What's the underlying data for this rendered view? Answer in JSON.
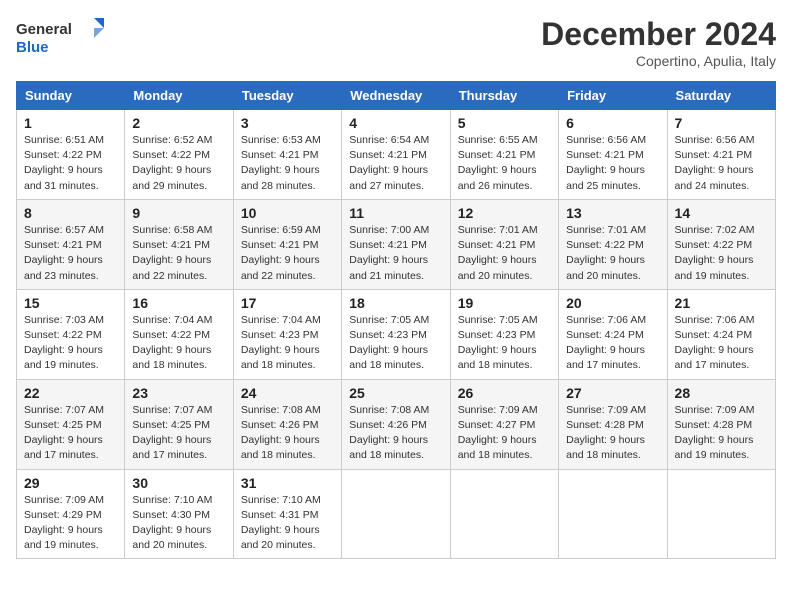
{
  "header": {
    "logo_line1": "General",
    "logo_line2": "Blue",
    "month": "December 2024",
    "location": "Copertino, Apulia, Italy"
  },
  "weekdays": [
    "Sunday",
    "Monday",
    "Tuesday",
    "Wednesday",
    "Thursday",
    "Friday",
    "Saturday"
  ],
  "weeks": [
    [
      {
        "day": "1",
        "sunrise": "6:51 AM",
        "sunset": "4:22 PM",
        "daylight": "9 hours and 31 minutes."
      },
      {
        "day": "2",
        "sunrise": "6:52 AM",
        "sunset": "4:22 PM",
        "daylight": "9 hours and 29 minutes."
      },
      {
        "day": "3",
        "sunrise": "6:53 AM",
        "sunset": "4:21 PM",
        "daylight": "9 hours and 28 minutes."
      },
      {
        "day": "4",
        "sunrise": "6:54 AM",
        "sunset": "4:21 PM",
        "daylight": "9 hours and 27 minutes."
      },
      {
        "day": "5",
        "sunrise": "6:55 AM",
        "sunset": "4:21 PM",
        "daylight": "9 hours and 26 minutes."
      },
      {
        "day": "6",
        "sunrise": "6:56 AM",
        "sunset": "4:21 PM",
        "daylight": "9 hours and 25 minutes."
      },
      {
        "day": "7",
        "sunrise": "6:56 AM",
        "sunset": "4:21 PM",
        "daylight": "9 hours and 24 minutes."
      }
    ],
    [
      {
        "day": "8",
        "sunrise": "6:57 AM",
        "sunset": "4:21 PM",
        "daylight": "9 hours and 23 minutes."
      },
      {
        "day": "9",
        "sunrise": "6:58 AM",
        "sunset": "4:21 PM",
        "daylight": "9 hours and 22 minutes."
      },
      {
        "day": "10",
        "sunrise": "6:59 AM",
        "sunset": "4:21 PM",
        "daylight": "9 hours and 22 minutes."
      },
      {
        "day": "11",
        "sunrise": "7:00 AM",
        "sunset": "4:21 PM",
        "daylight": "9 hours and 21 minutes."
      },
      {
        "day": "12",
        "sunrise": "7:01 AM",
        "sunset": "4:21 PM",
        "daylight": "9 hours and 20 minutes."
      },
      {
        "day": "13",
        "sunrise": "7:01 AM",
        "sunset": "4:22 PM",
        "daylight": "9 hours and 20 minutes."
      },
      {
        "day": "14",
        "sunrise": "7:02 AM",
        "sunset": "4:22 PM",
        "daylight": "9 hours and 19 minutes."
      }
    ],
    [
      {
        "day": "15",
        "sunrise": "7:03 AM",
        "sunset": "4:22 PM",
        "daylight": "9 hours and 19 minutes."
      },
      {
        "day": "16",
        "sunrise": "7:04 AM",
        "sunset": "4:22 PM",
        "daylight": "9 hours and 18 minutes."
      },
      {
        "day": "17",
        "sunrise": "7:04 AM",
        "sunset": "4:23 PM",
        "daylight": "9 hours and 18 minutes."
      },
      {
        "day": "18",
        "sunrise": "7:05 AM",
        "sunset": "4:23 PM",
        "daylight": "9 hours and 18 minutes."
      },
      {
        "day": "19",
        "sunrise": "7:05 AM",
        "sunset": "4:23 PM",
        "daylight": "9 hours and 18 minutes."
      },
      {
        "day": "20",
        "sunrise": "7:06 AM",
        "sunset": "4:24 PM",
        "daylight": "9 hours and 17 minutes."
      },
      {
        "day": "21",
        "sunrise": "7:06 AM",
        "sunset": "4:24 PM",
        "daylight": "9 hours and 17 minutes."
      }
    ],
    [
      {
        "day": "22",
        "sunrise": "7:07 AM",
        "sunset": "4:25 PM",
        "daylight": "9 hours and 17 minutes."
      },
      {
        "day": "23",
        "sunrise": "7:07 AM",
        "sunset": "4:25 PM",
        "daylight": "9 hours and 17 minutes."
      },
      {
        "day": "24",
        "sunrise": "7:08 AM",
        "sunset": "4:26 PM",
        "daylight": "9 hours and 18 minutes."
      },
      {
        "day": "25",
        "sunrise": "7:08 AM",
        "sunset": "4:26 PM",
        "daylight": "9 hours and 18 minutes."
      },
      {
        "day": "26",
        "sunrise": "7:09 AM",
        "sunset": "4:27 PM",
        "daylight": "9 hours and 18 minutes."
      },
      {
        "day": "27",
        "sunrise": "7:09 AM",
        "sunset": "4:28 PM",
        "daylight": "9 hours and 18 minutes."
      },
      {
        "day": "28",
        "sunrise": "7:09 AM",
        "sunset": "4:28 PM",
        "daylight": "9 hours and 19 minutes."
      }
    ],
    [
      {
        "day": "29",
        "sunrise": "7:09 AM",
        "sunset": "4:29 PM",
        "daylight": "9 hours and 19 minutes."
      },
      {
        "day": "30",
        "sunrise": "7:10 AM",
        "sunset": "4:30 PM",
        "daylight": "9 hours and 20 minutes."
      },
      {
        "day": "31",
        "sunrise": "7:10 AM",
        "sunset": "4:31 PM",
        "daylight": "9 hours and 20 minutes."
      },
      null,
      null,
      null,
      null
    ]
  ]
}
